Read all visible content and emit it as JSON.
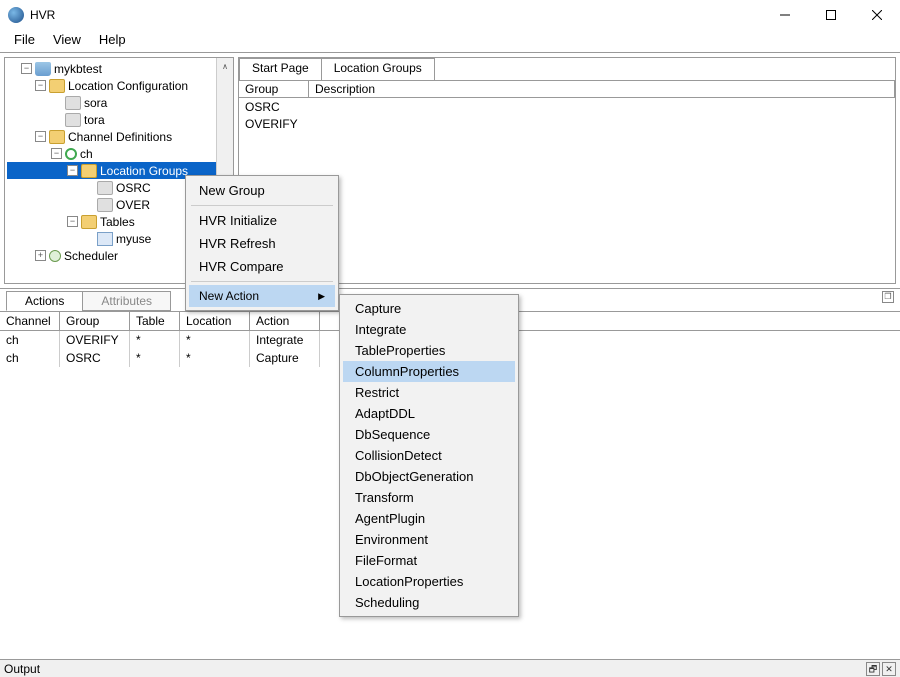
{
  "window": {
    "title": "HVR"
  },
  "menubar": {
    "file": "File",
    "view": "View",
    "help": "Help"
  },
  "tree": {
    "root": "mykbtest",
    "loc_config": "Location Configuration",
    "sora": "sora",
    "tora": "tora",
    "ch_def": "Channel Definitions",
    "ch": "ch",
    "loc_groups": "Location Groups",
    "osrc": "OSRC",
    "over": "OVER",
    "tables": "Tables",
    "myuse": "myuse",
    "scheduler": "Scheduler"
  },
  "right_panel": {
    "tabs": {
      "start": "Start Page",
      "loc_groups": "Location Groups"
    },
    "columns": {
      "group": "Group",
      "description": "Description"
    },
    "rows": [
      "OSRC",
      "OVERIFY"
    ]
  },
  "mid_panel": {
    "tabs": {
      "actions": "Actions",
      "attributes": "Attributes"
    },
    "columns": {
      "channel": "Channel",
      "group": "Group",
      "table": "Table",
      "location": "Location",
      "action": "Action"
    },
    "rows": [
      {
        "channel": "ch",
        "group": "OVERIFY",
        "table": "*",
        "location": "*",
        "action": "Integrate"
      },
      {
        "channel": "ch",
        "group": "OSRC",
        "table": "*",
        "location": "*",
        "action": "Capture"
      }
    ]
  },
  "context_menu_1": {
    "new_group": "New Group",
    "hvr_initialize": "HVR Initialize",
    "hvr_refresh": "HVR Refresh",
    "hvr_compare": "HVR Compare",
    "new_action": "New Action"
  },
  "context_menu_2": {
    "items": [
      "Capture",
      "Integrate",
      "TableProperties",
      "ColumnProperties",
      "Restrict",
      "AdaptDDL",
      "DbSequence",
      "CollisionDetect",
      "DbObjectGeneration",
      "Transform",
      "AgentPlugin",
      "Environment",
      "FileFormat",
      "LocationProperties",
      "Scheduling"
    ],
    "highlighted": "ColumnProperties"
  },
  "output": {
    "label": "Output"
  }
}
